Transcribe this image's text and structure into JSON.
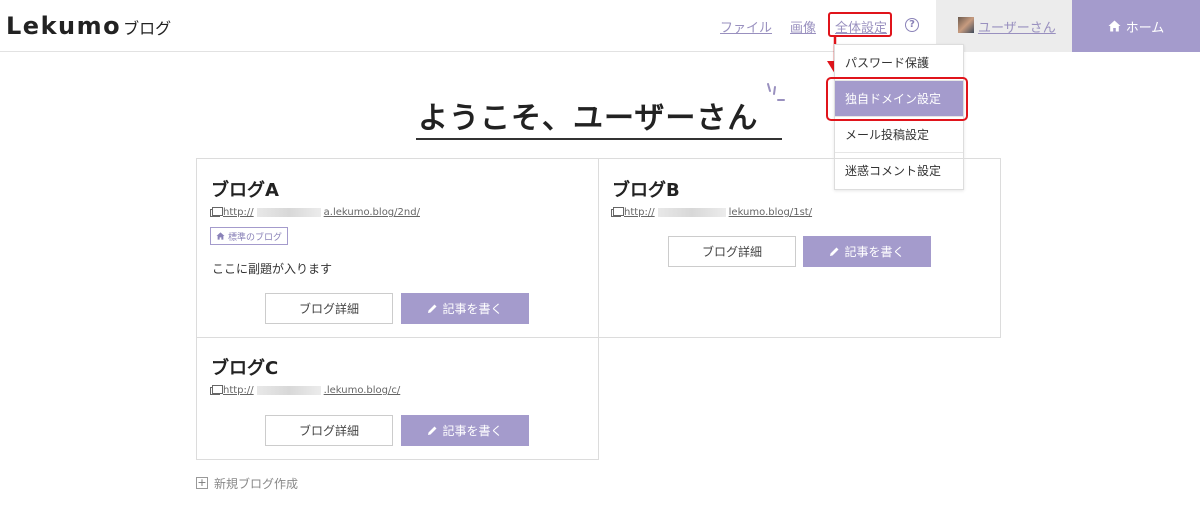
{
  "header": {
    "logo": "Lekumo",
    "logo_sub": "ブログ",
    "nav": {
      "file": "ファイル",
      "image": "画像",
      "settings": "全体設定"
    },
    "help": "?",
    "user": "ユーザーさん",
    "home": "ホーム"
  },
  "dropdown": {
    "items": [
      "パスワード保護",
      "独自ドメイン設定",
      "メール投稿設定",
      "迷惑コメント設定"
    ],
    "active_index": 1
  },
  "welcome": "ようこそ、ユーザーさん",
  "blogs": [
    {
      "title": "ブログA",
      "url_prefix": "http://",
      "url_suffix": "a.lekumo.blog/2nd/",
      "badge": "標準のブログ",
      "subtitle": "ここに副題が入ります",
      "detail": "ブログ詳細",
      "write": "記事を書く"
    },
    {
      "title": "ブログB",
      "url_prefix": "http://",
      "url_suffix": "lekumo.blog/1st/",
      "detail": "ブログ詳細",
      "write": "記事を書く"
    },
    {
      "title": "ブログC",
      "url_prefix": "http://",
      "url_suffix": ".lekumo.blog/c/",
      "detail": "ブログ詳細",
      "write": "記事を書く"
    }
  ],
  "new_blog": "新規ブログ作成",
  "colors": {
    "accent": "#a49bcc",
    "link": "#9990bf",
    "highlight": "#e0141b"
  }
}
